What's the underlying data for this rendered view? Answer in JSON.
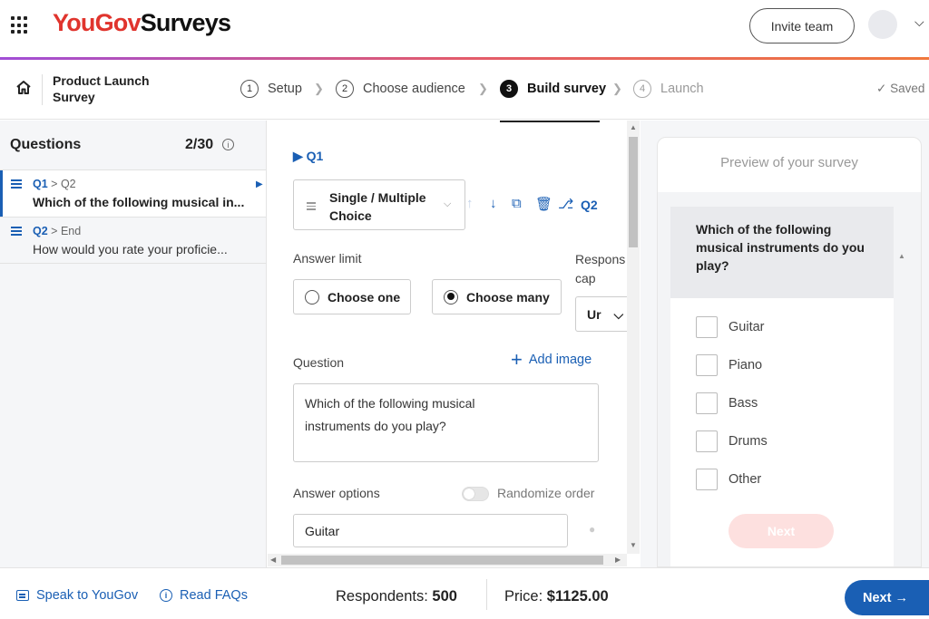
{
  "app": {
    "logo_part1": "YouGov",
    "logo_part2": "Surveys",
    "invite_label": "Invite team"
  },
  "project": {
    "title": "Product Launch Survey"
  },
  "steps": [
    {
      "num": "1",
      "label": "Setup",
      "state": "done"
    },
    {
      "num": "2",
      "label": "Choose audience",
      "state": "done"
    },
    {
      "num": "3",
      "label": "Build survey",
      "state": "active"
    },
    {
      "num": "4",
      "label": "Launch",
      "state": "disabled"
    }
  ],
  "saved_label": "Saved",
  "sidebar": {
    "title": "Questions",
    "count": "2/30",
    "questions": [
      {
        "id": "Q1",
        "route": "> Q2",
        "text": "Which of the following musical in..."
      },
      {
        "id": "Q2",
        "route": "> End",
        "text": "How would you rate your proficie..."
      }
    ]
  },
  "editor": {
    "question_id": "Q1",
    "question_type": "Single / Multiple Choice",
    "next_question_link": "Q2",
    "answer_limit_label": "Answer limit",
    "choose_one_label": "Choose one",
    "choose_many_label": "Choose many",
    "response_cap_label": "Respons cap",
    "response_cap_value": "Ur",
    "question_label": "Question",
    "add_image_label": "Add image",
    "question_text": "Which of the following musical instruments do you play?",
    "answer_options_label": "Answer options",
    "randomize_label": "Randomize order",
    "first_option_value": "Guitar"
  },
  "preview": {
    "title": "Preview of your survey",
    "question": "Which of the following musical instruments do you play?",
    "options": [
      "Guitar",
      "Piano",
      "Bass",
      "Drums",
      "Other"
    ],
    "next_label": "Next"
  },
  "footer": {
    "speak_label": "Speak to YouGov",
    "faq_label": "Read FAQs",
    "respondents_label": "Respondents:",
    "respondents_value": "500",
    "price_label": "Price:",
    "price_value": "$1125.00",
    "next_label": "Next"
  },
  "colors": {
    "brand_red": "#e0342d",
    "accent_blue": "#1a5fb4"
  }
}
